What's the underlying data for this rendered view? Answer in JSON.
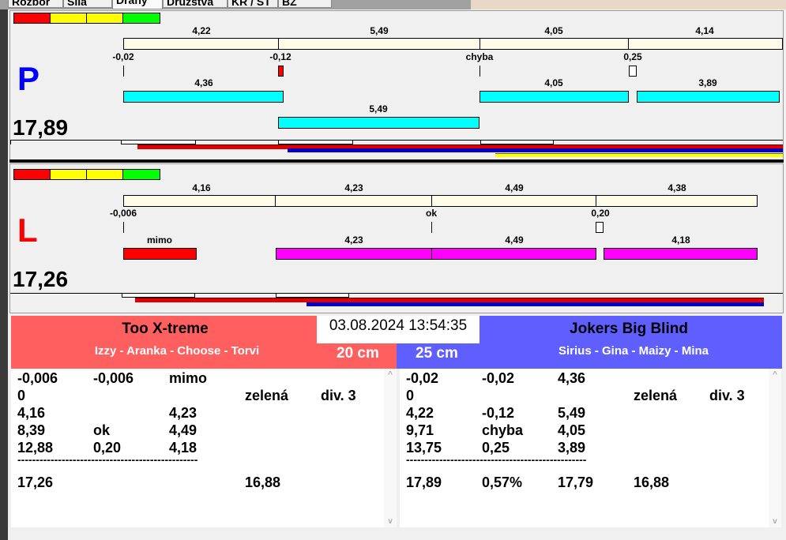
{
  "tabs": [
    "Rozbor",
    "Síla",
    "Dráhy",
    "Družstva",
    "KR / ST",
    "BZ"
  ],
  "panel_p": {
    "letter": "P",
    "total": "17,89",
    "top_labels": [
      "4,22",
      "5,49",
      "4,05",
      "4,14"
    ],
    "offset_labels": [
      "-0,02",
      "-0,12",
      "chyba",
      "0,25"
    ],
    "row1_labels": [
      "4,36",
      "4,05",
      "3,89"
    ],
    "row2_labels": [
      "5,49"
    ]
  },
  "panel_l": {
    "letter": "L",
    "total": "17,26",
    "top_labels": [
      "4,16",
      "4,23",
      "4,49",
      "4,38"
    ],
    "offset_labels": [
      "-0,006",
      "ok",
      "0,20"
    ],
    "row1_labels": [
      "mimo",
      "4,23",
      "4,49",
      "4,18"
    ]
  },
  "datetime": "03.08.2024 13:54:35",
  "team_left": {
    "name": "Too X-treme",
    "players": "Izzy - Aranka - Choose - Torvi",
    "distance": "20 cm",
    "color": "#ff5f5f",
    "rows": [
      [
        "-0,006",
        "-0,006",
        "mimo",
        "",
        ""
      ],
      [
        "0",
        "",
        "",
        "zelená",
        "div. 3"
      ],
      [
        "4,16",
        "",
        "4,23",
        "",
        ""
      ],
      [
        "8,39",
        "ok",
        "4,49",
        "",
        ""
      ],
      [
        "12,88",
        "0,20",
        "4,18",
        "",
        ""
      ]
    ],
    "separator": "-------------------------------------------------",
    "total_row": [
      "17,26",
      "",
      "",
      "16,88",
      ""
    ]
  },
  "team_right": {
    "name": "Jokers Big Blind",
    "players": "Sirius - Gina - Maizy - Mina",
    "distance": "25 cm",
    "color": "#5f5fff",
    "rows": [
      [
        "-0,02",
        "-0,02",
        "4,36",
        "",
        ""
      ],
      [
        "0",
        "",
        "",
        "zelená",
        "div. 3"
      ],
      [
        "4,22",
        "-0,12",
        "5,49",
        "",
        ""
      ],
      [
        "9,71",
        "chyba",
        "4,05",
        "",
        ""
      ],
      [
        "13,75",
        "0,25",
        "3,89",
        "",
        ""
      ]
    ],
    "separator": "-------------------------------------------------",
    "total_row": [
      "17,89",
      "0,57%",
      "17,79",
      "16,88",
      ""
    ]
  }
}
